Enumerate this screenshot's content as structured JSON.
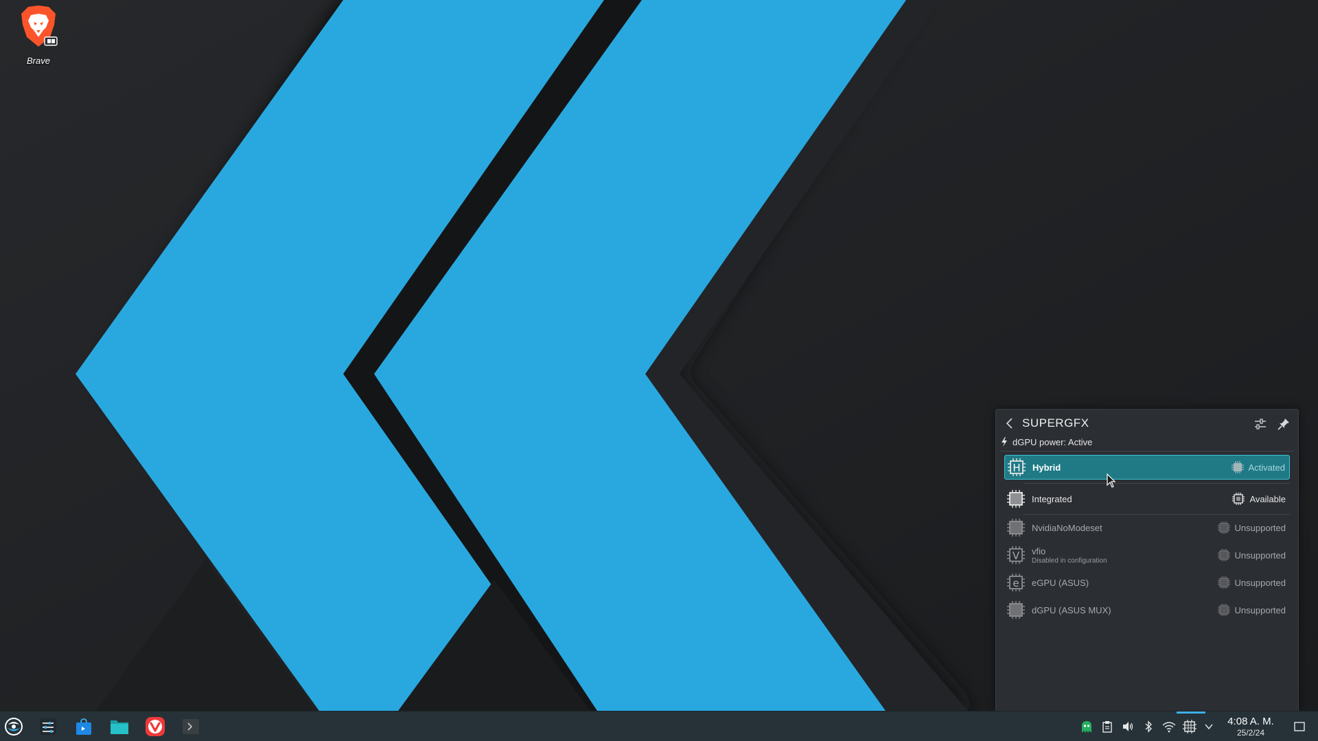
{
  "desktop": {
    "icons": [
      {
        "label": "Brave"
      }
    ]
  },
  "popup": {
    "title": "SUPERGFX",
    "power_status": "dGPU power: Active",
    "modes": [
      {
        "name": "Hybrid",
        "sub": "",
        "status": "Activated",
        "letter": "H",
        "state": "active"
      },
      {
        "name": "Integrated",
        "sub": "",
        "status": "Available",
        "letter": "",
        "state": "available"
      },
      {
        "name": "NvidiaNoModeset",
        "sub": "",
        "status": "Unsupported",
        "letter": "",
        "state": "unsupported"
      },
      {
        "name": "vfio",
        "sub": "Disabled in configuration",
        "status": "Unsupported",
        "letter": "V",
        "state": "unsupported"
      },
      {
        "name": "eGPU (ASUS)",
        "sub": "",
        "status": "Unsupported",
        "letter": "e",
        "state": "unsupported"
      },
      {
        "name": "dGPU (ASUS MUX)",
        "sub": "",
        "status": "Unsupported",
        "letter": "",
        "state": "unsupported"
      }
    ]
  },
  "taskbar": {
    "clock": {
      "time": "4:08 A. M.",
      "date": "25/2/24"
    },
    "apps": [
      "app-launcher",
      "system-settings",
      "discover-store",
      "file-manager",
      "vivaldi-browser",
      "terminal"
    ],
    "tray": [
      "ghost-icon",
      "clipboard-icon",
      "volume-icon",
      "bluetooth-icon",
      "wifi-icon",
      "gpu-chip-icon",
      "tray-expand-icon"
    ]
  },
  "colors": {
    "accent": "#3daee9",
    "active_row": "#1f7a86",
    "wallpaper_blue": "#29a8e0",
    "panel_bg": "#2b2e33",
    "taskbar_bg": "#263238"
  }
}
